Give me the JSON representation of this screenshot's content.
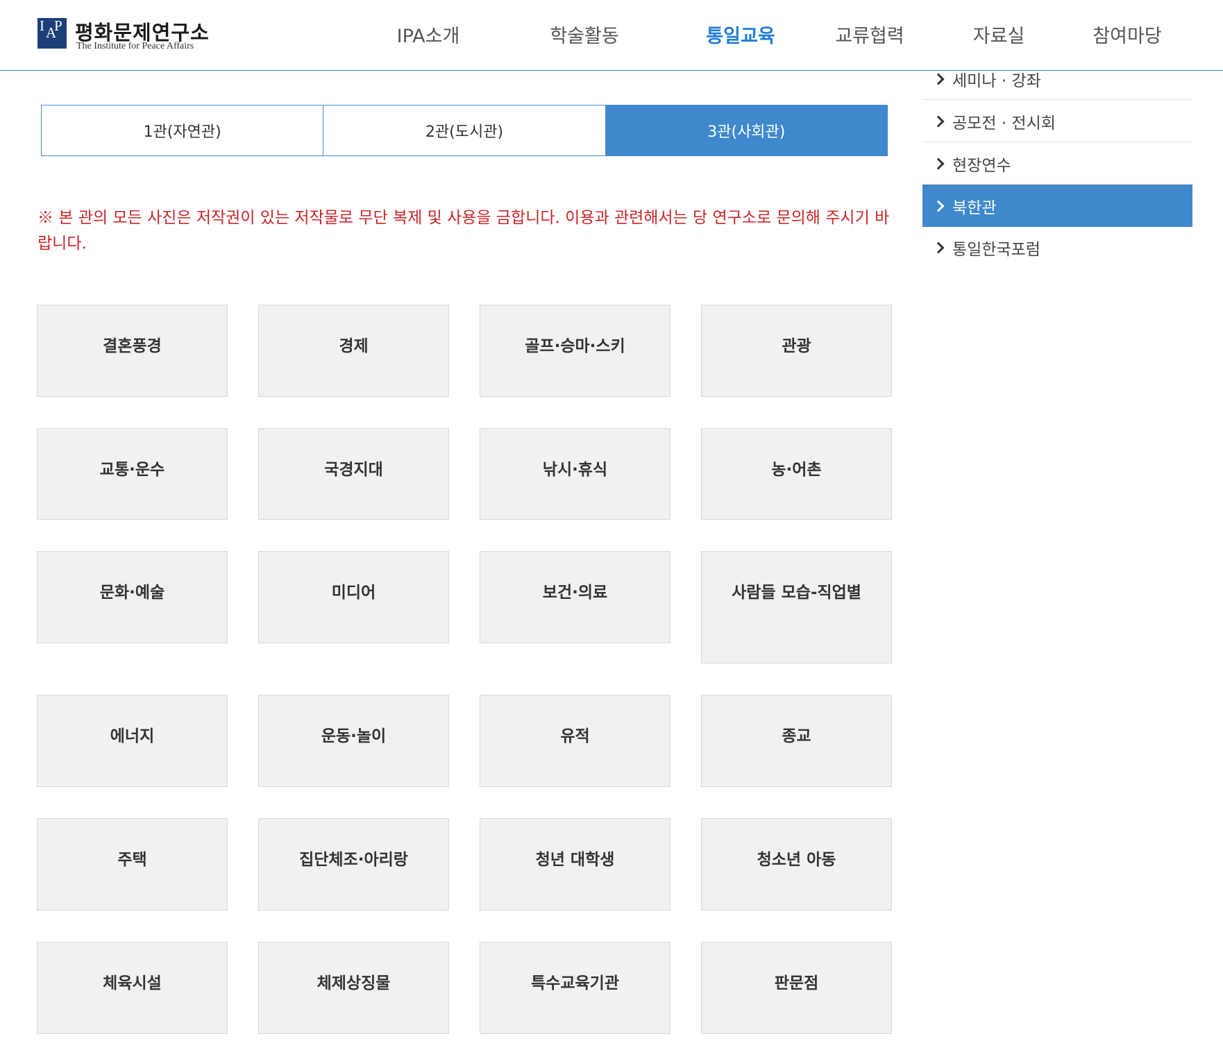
{
  "header": {
    "logo_ko": "평화문제연구소",
    "logo_en": "The Institute for Peace Affairs",
    "nav": [
      {
        "label": "IPA소개"
      },
      {
        "label": "학술활동"
      },
      {
        "label": "통일교육",
        "active": true
      },
      {
        "label": "교류협력"
      },
      {
        "label": "자료실"
      },
      {
        "label": "참여마당"
      }
    ]
  },
  "tabs": [
    {
      "label": "1관(자연관)"
    },
    {
      "label": "2관(도시관)"
    },
    {
      "label": "3관(사회관)",
      "active": true
    }
  ],
  "notice": "※ 본 관의 모든 사진은 저작권이 있는 저작물로 무단 복제 및 사용을 금합니다. 이용과 관련해서는 당 연구소로 문의해 주시기 바랍니다.",
  "categories": [
    "결혼풍경",
    "경제",
    "골프·승마·스키",
    "관광",
    "교통·운수",
    "국경지대",
    "낚시·휴식",
    "농·어촌",
    "문화·예술",
    "미디어",
    "보건·의료",
    "사람들 모습-직업별",
    "에너지",
    "운동·놀이",
    "유적",
    "종교",
    "주택",
    "집단체조·아리랑",
    "청년 대학생",
    "청소년 아동",
    "체육시설",
    "체제상징물",
    "특수교육기관",
    "판문점"
  ],
  "sidebar": {
    "items": [
      {
        "label": "세미나 · 강좌"
      },
      {
        "label": "공모전 · 전시회"
      },
      {
        "label": "현장연수"
      },
      {
        "label": "북한관",
        "active": true
      },
      {
        "label": "통일한국포럼"
      }
    ]
  },
  "colors": {
    "accent": "#3f88cc",
    "nav_active": "#1f7ed6",
    "notice": "#c8262a",
    "cell_bg": "#f0f1f3"
  }
}
